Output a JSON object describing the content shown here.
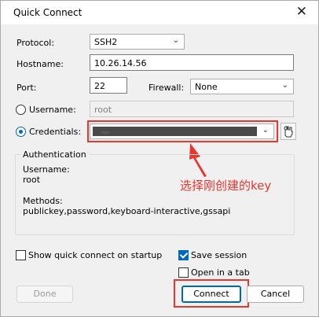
{
  "window": {
    "title": "Quick Connect",
    "close_glyph": "✕"
  },
  "protocol": {
    "label": "Protocol:",
    "value": "SSH2"
  },
  "hostname": {
    "label": "Hostname:",
    "value": "10.26.14.56"
  },
  "port": {
    "label": "Port:",
    "value": "22"
  },
  "firewall": {
    "label": "Firewall:",
    "value": "None"
  },
  "username": {
    "label": "Username:",
    "value": "root"
  },
  "credentials": {
    "label": "Credentials:",
    "value": "...."
  },
  "authentication": {
    "title": "Authentication",
    "username_label": "Username:",
    "username_value": "root",
    "methods_label": "Methods:",
    "methods_value": "publickey,password,keyboard-interactive,gssapi"
  },
  "annotation": {
    "text": "选择刚创建的key",
    "color": "#e8372e"
  },
  "options": {
    "show_quick_connect": "Show quick connect on startup",
    "save_session": "Save session",
    "open_in_tab": "Open in a tab"
  },
  "buttons": {
    "done": "Done",
    "connect": "Connect",
    "cancel": "Cancel"
  },
  "accent_color": "#0067c0"
}
